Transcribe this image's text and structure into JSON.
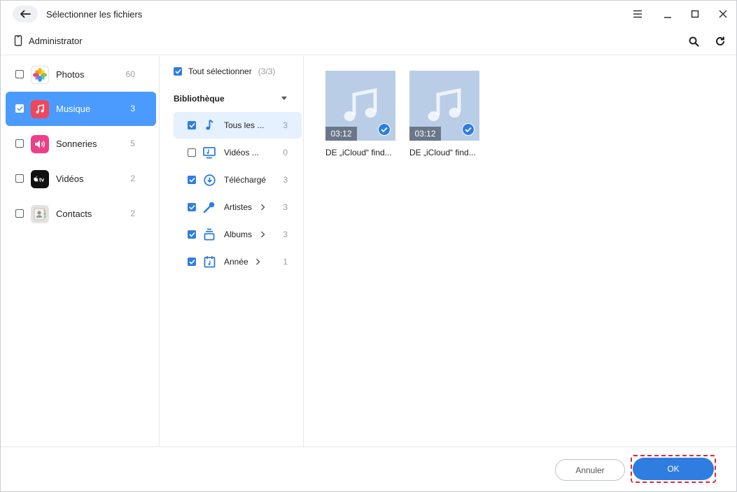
{
  "window": {
    "title": "Sélectionner les fichiers",
    "device_name": "Administrator"
  },
  "sidebar": {
    "items": [
      {
        "label": "Photos",
        "count": "60",
        "icon": "photos-app-icon",
        "checked": false,
        "active": false
      },
      {
        "label": "Musique",
        "count": "3",
        "icon": "music-app-icon",
        "checked": true,
        "active": true
      },
      {
        "label": "Sonneries",
        "count": "5",
        "icon": "ringtones-app-icon",
        "checked": false,
        "active": false
      },
      {
        "label": "Vidéos",
        "count": "2",
        "icon": "apple-tv-app-icon",
        "checked": false,
        "active": false
      },
      {
        "label": "Contacts",
        "count": "2",
        "icon": "contacts-app-icon",
        "checked": false,
        "active": false
      }
    ]
  },
  "library": {
    "select_all_label": "Tout sélectionner",
    "select_all_count": "(3/3)",
    "header": "Bibliothèque",
    "items": [
      {
        "label": "Tous les ...",
        "count": "3",
        "icon": "music-note-icon",
        "checked": true,
        "active": true,
        "has_arrow": false
      },
      {
        "label": "Vidéos ...",
        "count": "0",
        "icon": "music-video-icon",
        "checked": false,
        "active": false,
        "has_arrow": false
      },
      {
        "label": "Téléchargé",
        "count": "3",
        "icon": "download-icon",
        "checked": true,
        "active": false,
        "has_arrow": false
      },
      {
        "label": "Artistes",
        "count": "3",
        "icon": "microphone-icon",
        "checked": true,
        "active": false,
        "has_arrow": true
      },
      {
        "label": "Albums",
        "count": "3",
        "icon": "album-stack-icon",
        "checked": true,
        "active": false,
        "has_arrow": true
      },
      {
        "label": "Année",
        "count": "1",
        "icon": "calendar-icon",
        "checked": true,
        "active": false,
        "has_arrow": true
      }
    ]
  },
  "files": [
    {
      "duration": "03:12",
      "name": "DE „iCloud“ find...",
      "selected": true
    },
    {
      "duration": "03:12",
      "name": "DE „iCloud“ find...",
      "selected": true
    }
  ],
  "footer": {
    "cancel_label": "Annuler",
    "ok_label": "OK"
  },
  "colors": {
    "accent": "#2f7de1",
    "active_category": "#4b9bff",
    "active_subitem": "#e6f1ff",
    "thumbnail": "#b9cde6",
    "highlight_frame": "#e2282f"
  }
}
